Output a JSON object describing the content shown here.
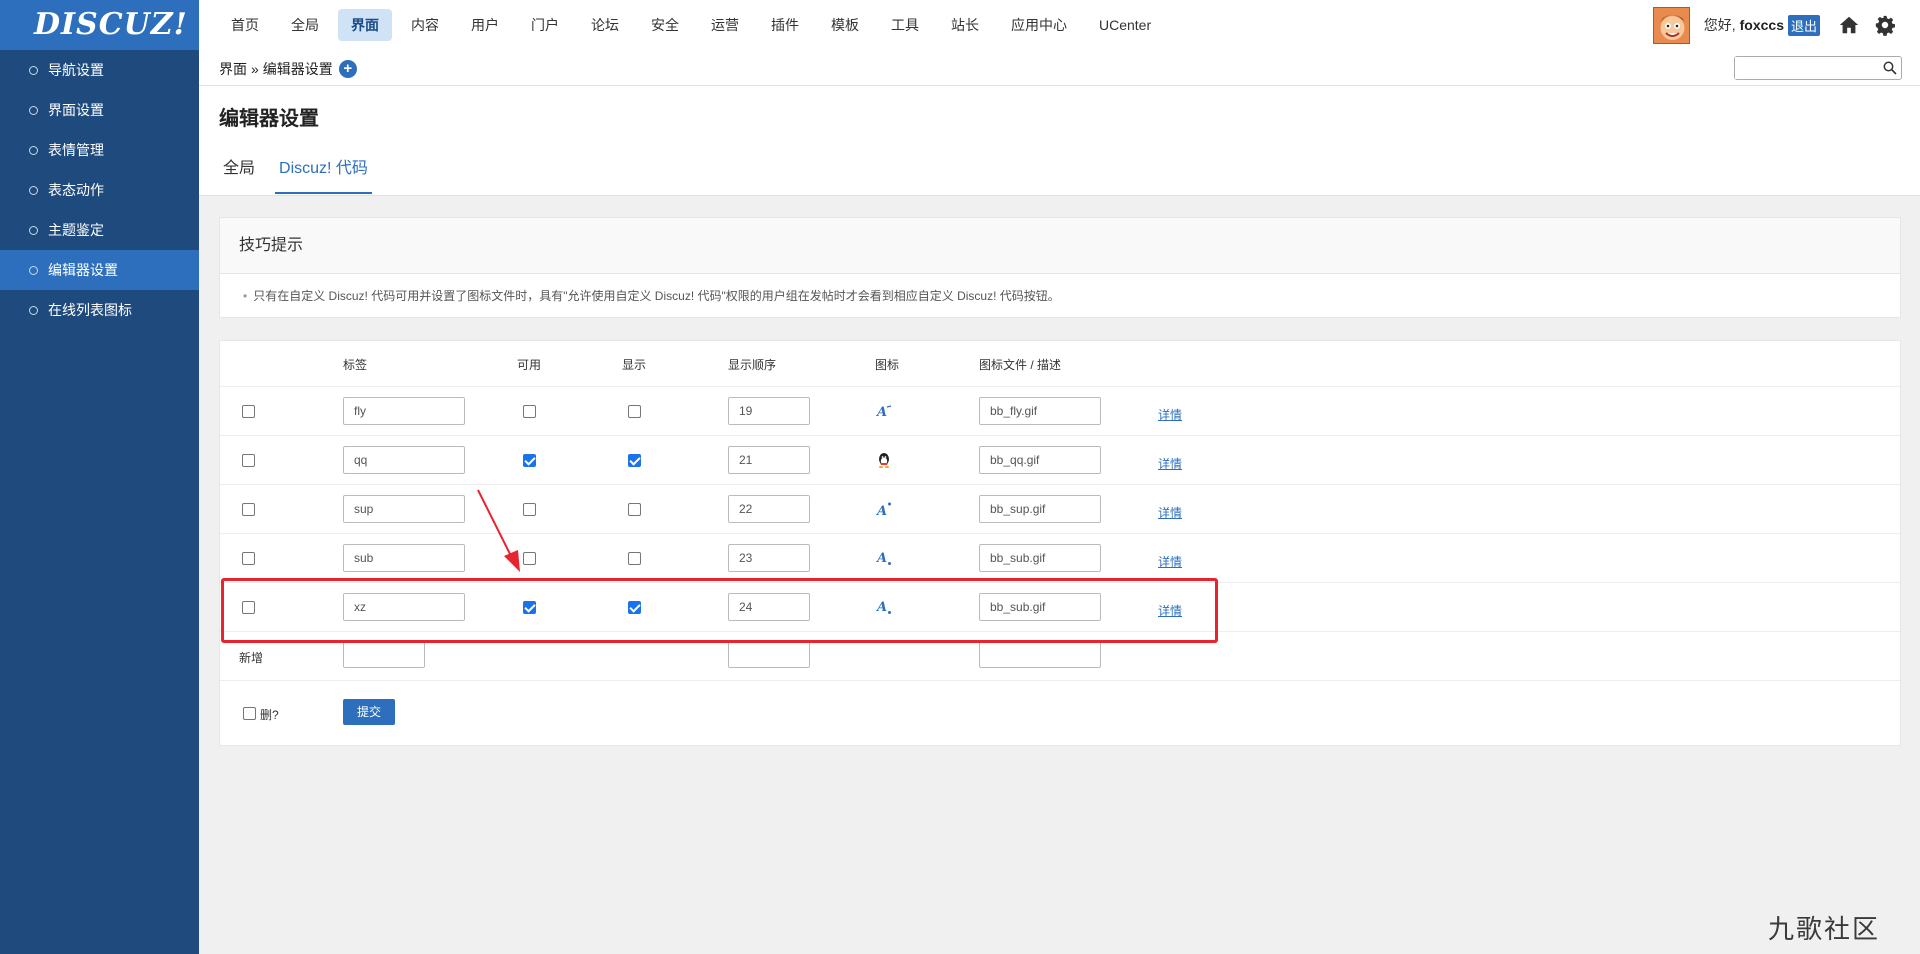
{
  "brand": {
    "logo": "DISCUZ!"
  },
  "topnav": [
    "首页",
    "全局",
    "界面",
    "内容",
    "用户",
    "门户",
    "论坛",
    "安全",
    "运营",
    "插件",
    "模板",
    "工具",
    "站长",
    "应用中心",
    "UCenter"
  ],
  "user": {
    "greeting": "您好,",
    "name": "foxccs",
    "logout": "退出"
  },
  "sidebar": [
    "导航设置",
    "界面设置",
    "表情管理",
    "表态动作",
    "主题鉴定",
    "编辑器设置",
    "在线列表图标"
  ],
  "breadcrumb": {
    "section": "界面",
    "sep": "»",
    "page": "编辑器设置",
    "add": "+"
  },
  "search": {
    "placeholder": ""
  },
  "page": {
    "title": "编辑器设置",
    "tabs": [
      "全局",
      "Discuz! 代码"
    ]
  },
  "tips": {
    "title": "技巧提示",
    "text": "只有在自定义 Discuz! 代码可用并设置了图标文件时，具有\"允许使用自定义 Discuz! 代码\"权限的用户组在发帖时才会看到相应自定义 Discuz! 代码按钮。"
  },
  "table": {
    "headers": [
      "标签",
      "可用",
      "显示",
      "显示顺序",
      "图标",
      "图标文件 / 描述"
    ],
    "rows": [
      {
        "tag": "fly",
        "enabled": false,
        "shown": false,
        "order": "19",
        "icon": "font-fly-icon",
        "file": "bb_fly.gif",
        "detail": "详情"
      },
      {
        "tag": "qq",
        "enabled": true,
        "shown": true,
        "order": "21",
        "icon": "qq-penguin-icon",
        "file": "bb_qq.gif",
        "detail": "详情"
      },
      {
        "tag": "sup",
        "enabled": false,
        "shown": false,
        "order": "22",
        "icon": "font-sup-icon",
        "file": "bb_sup.gif",
        "detail": "详情"
      },
      {
        "tag": "sub",
        "enabled": false,
        "shown": false,
        "order": "23",
        "icon": "font-sub-icon",
        "file": "bb_sub.gif",
        "detail": "详情"
      },
      {
        "tag": "xz",
        "enabled": true,
        "shown": true,
        "order": "24",
        "icon": "font-sub-icon",
        "file": "bb_sub.gif",
        "detail": "详情"
      }
    ],
    "new_label": "新增",
    "delete_label": "删?",
    "submit": "提交"
  },
  "watermark": "九歌社区",
  "colors": {
    "accent": "#2d6fbd",
    "sidebar": "#1f4a7e",
    "highlight": "#e8242e"
  }
}
